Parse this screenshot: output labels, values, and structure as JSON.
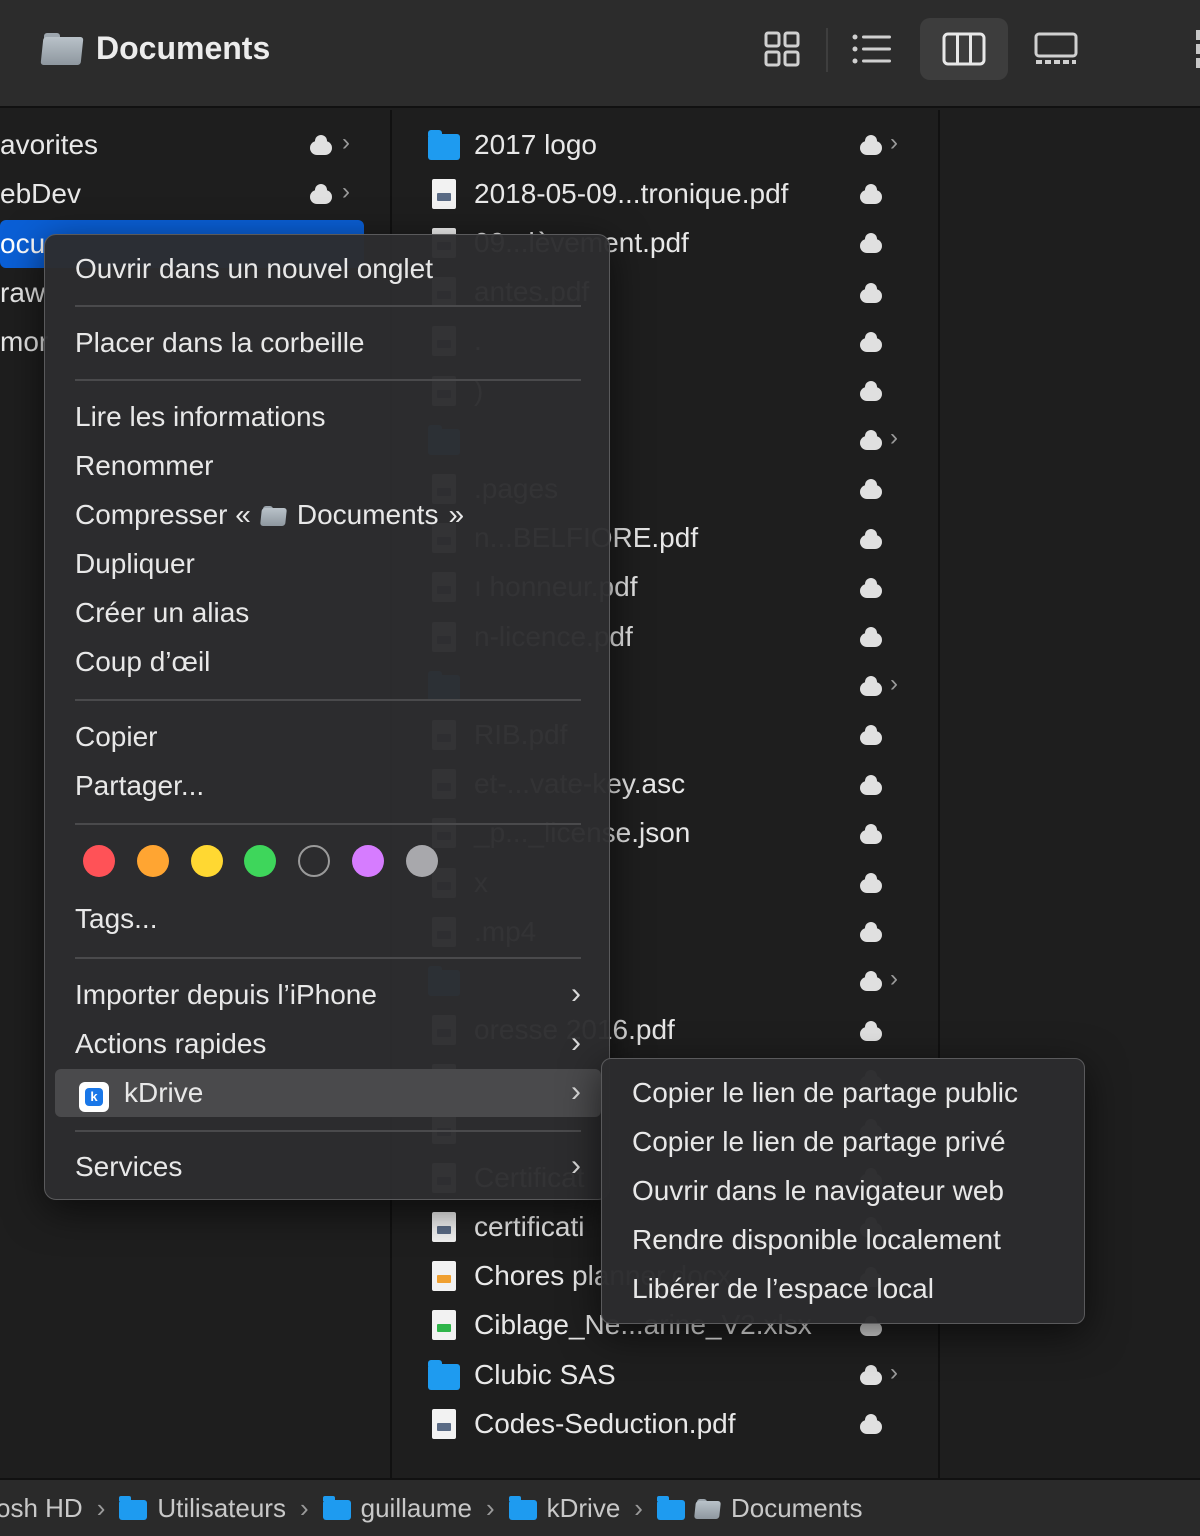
{
  "window": {
    "title": "Documents"
  },
  "sidebar": {
    "items": [
      {
        "label": "avorites"
      },
      {
        "label": "ebDev"
      },
      {
        "label": "ocu"
      },
      {
        "label": "raw"
      },
      {
        "label": "mor"
      }
    ]
  },
  "files": [
    {
      "name": "2017 logo",
      "type": "folder"
    },
    {
      "name": "2018-05-09...tronique.pdf",
      "type": "pdf"
    },
    {
      "name": "09...lèvement.pdf",
      "type": "pdf"
    },
    {
      "name": "antes.pdf",
      "type": "pdf"
    },
    {
      "name": ".",
      "type": "pdf"
    },
    {
      "name": ")",
      "type": "pdf"
    },
    {
      "name": "",
      "type": "folder"
    },
    {
      "name": ".pages",
      "type": "pdf"
    },
    {
      "name": "n...BELFIORE.pdf",
      "type": "pdf"
    },
    {
      "name": "ı honneur.pdf",
      "type": "pdf"
    },
    {
      "name": "n-licence.pdf",
      "type": "pdf"
    },
    {
      "name": "",
      "type": "folder"
    },
    {
      "name": "RIB.pdf",
      "type": "pdf"
    },
    {
      "name": "et-...vate-key.asc",
      "type": "pdf"
    },
    {
      "name": "_p..._license.json",
      "type": "pdf"
    },
    {
      "name": "x",
      "type": "pdf"
    },
    {
      "name": ".mp4",
      "type": "pdf"
    },
    {
      "name": "",
      "type": "folder"
    },
    {
      "name": "oresse 2016.pdf",
      "type": "pdf"
    },
    {
      "name": "",
      "type": "pdf"
    },
    {
      "name": "",
      "type": "pdf"
    },
    {
      "name": "Certificat",
      "type": "pdf"
    },
    {
      "name": "certificati",
      "type": "pdf"
    },
    {
      "name": "Chores planner.docx",
      "type": "docx"
    },
    {
      "name": "Ciblage_Ne...arine_V2.xlsx",
      "type": "xlsx"
    },
    {
      "name": "Clubic SAS",
      "type": "folder"
    },
    {
      "name": "Codes-Seduction.pdf",
      "type": "pdf"
    }
  ],
  "context_menu": {
    "open_new_tab": "Ouvrir dans un nouvel onglet",
    "trash": "Placer dans la corbeille",
    "get_info": "Lire les informations",
    "rename": "Renommer",
    "compress_prefix": "Compresser «",
    "compress_name": "Documents",
    "compress_suffix": "»",
    "duplicate": "Dupliquer",
    "make_alias": "Créer un alias",
    "quick_look": "Coup d’œil",
    "copy": "Copier",
    "share": "Partager...",
    "tags": "Tags...",
    "import_iphone": "Importer depuis l’iPhone",
    "quick_actions": "Actions rapides",
    "kdrive": "kDrive",
    "services": "Services",
    "tag_colors": [
      "#ff5257",
      "#ffa532",
      "#ffd832",
      "#3ed65b",
      "transparent",
      "#d67cff",
      "#a8a8ac"
    ]
  },
  "kdrive_submenu": {
    "items": [
      "Copier le lien de partage public",
      "Copier le lien de partage privé",
      "Ouvrir dans le navigateur web",
      "Rendre disponible localement",
      "Libérer de l’espace local"
    ]
  },
  "pathbar": {
    "items": [
      "osh HD",
      "Utilisateurs",
      "guillaume",
      "kDrive",
      "Documents"
    ]
  }
}
